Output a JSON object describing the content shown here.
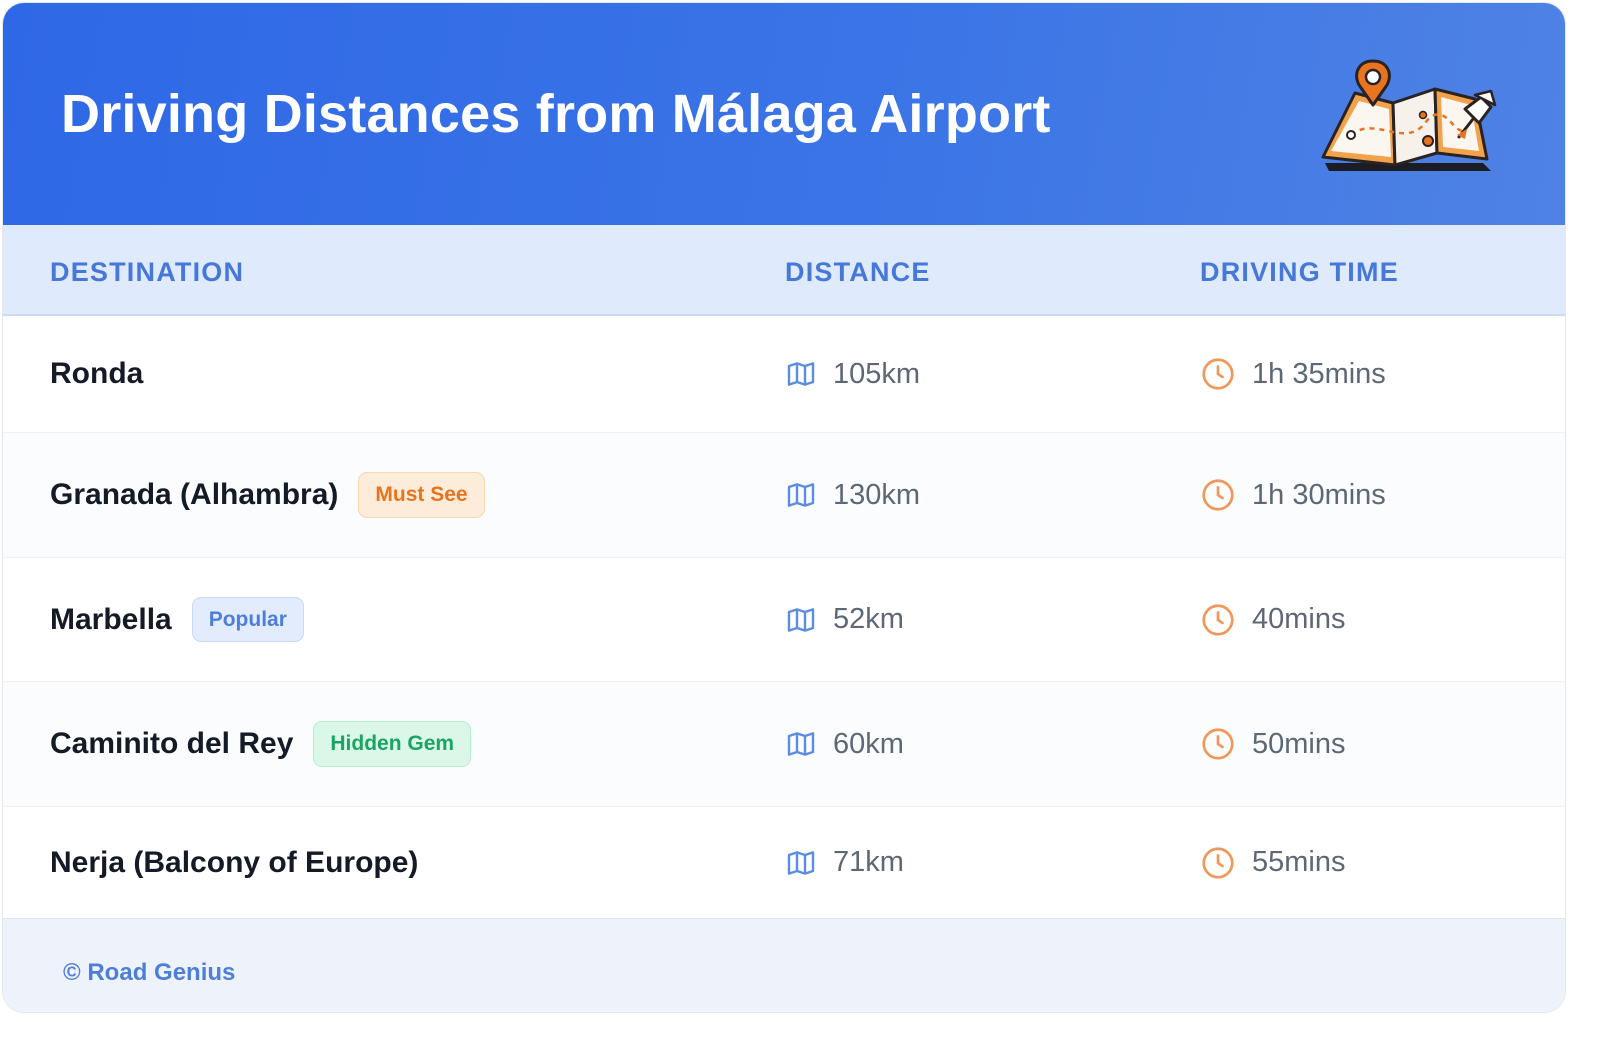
{
  "header": {
    "title": "Driving Distances from Málaga Airport",
    "illustration": "folded-map-with-pins-illustration"
  },
  "table": {
    "columns": [
      "DESTINATION",
      "DISTANCE",
      "DRIVING TIME"
    ],
    "rows": [
      {
        "destination": "Ronda",
        "badge": "",
        "distance": "105km",
        "time": "1h 35mins"
      },
      {
        "destination": "Granada (Alhambra)",
        "badge": "Must See",
        "distance": "130km",
        "time": "1h 30mins"
      },
      {
        "destination": "Marbella",
        "badge": "Popular",
        "distance": "52km",
        "time": "40mins"
      },
      {
        "destination": "Caminito del Rey",
        "badge": "Hidden Gem",
        "distance": "60km",
        "time": "50mins"
      },
      {
        "destination": "Nerja (Balcony of Europe)",
        "badge": "",
        "distance": "71km",
        "time": "55mins"
      }
    ],
    "icons": {
      "distance": "map-icon",
      "time": "clock-icon"
    }
  },
  "footer": {
    "credit": "© Road Genius"
  },
  "colors": {
    "header_blue": "#2f68e6",
    "accent_orange": "#e8741f",
    "badge_blue": "#4e7fd8",
    "badge_green": "#1aa564"
  }
}
